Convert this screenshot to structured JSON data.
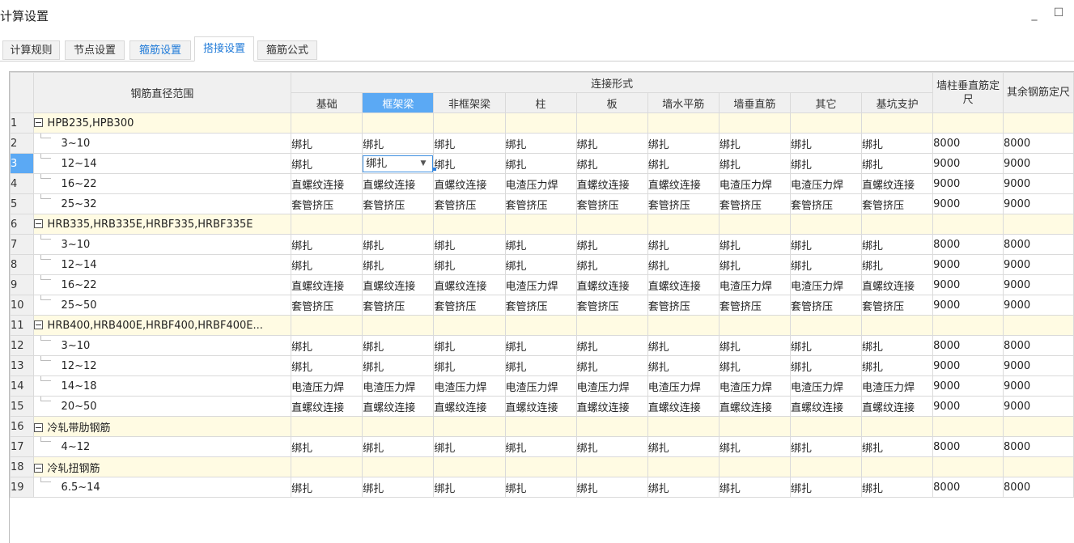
{
  "window": {
    "title": "计算设置",
    "minimize_glyph": "_",
    "maximize_glyph": "☐"
  },
  "tabs": [
    {
      "label": "计算规则"
    },
    {
      "label": "节点设置"
    },
    {
      "label": "箍筋设置"
    },
    {
      "label": "搭接设置"
    },
    {
      "label": "箍筋公式"
    }
  ],
  "table": {
    "header": {
      "diameter_range": "钢筋直径范围",
      "connection_form": "连接形式",
      "connection_columns": [
        "基础",
        "框架梁",
        "非框架梁",
        "柱",
        "板",
        "墙水平筋",
        "墙垂直筋",
        "其它",
        "基坑支护"
      ],
      "wall_col_length": "墙柱垂直筋定尺",
      "other_length": "其余钢筋定尺"
    },
    "rows": [
      {
        "num": "1",
        "type": "group",
        "name": "HPB235,HPB300"
      },
      {
        "num": "2",
        "type": "item",
        "name": "3~10",
        "values": [
          "绑扎",
          "绑扎",
          "绑扎",
          "绑扎",
          "绑扎",
          "绑扎",
          "绑扎",
          "绑扎",
          "绑扎"
        ],
        "wall": "8000",
        "other": "8000"
      },
      {
        "num": "3",
        "type": "item",
        "name": "12~14",
        "values": [
          "绑扎",
          "绑扎",
          "绑扎",
          "绑扎",
          "绑扎",
          "绑扎",
          "绑扎",
          "绑扎",
          "绑扎"
        ],
        "wall": "9000",
        "other": "9000"
      },
      {
        "num": "4",
        "type": "item",
        "name": "16~22",
        "values": [
          "直螺纹连接",
          "直螺纹连接",
          "直螺纹连接",
          "电渣压力焊",
          "直螺纹连接",
          "直螺纹连接",
          "电渣压力焊",
          "电渣压力焊",
          "直螺纹连接"
        ],
        "wall": "9000",
        "other": "9000"
      },
      {
        "num": "5",
        "type": "item",
        "name": "25~32",
        "values": [
          "套管挤压",
          "套管挤压",
          "套管挤压",
          "套管挤压",
          "套管挤压",
          "套管挤压",
          "套管挤压",
          "套管挤压",
          "套管挤压"
        ],
        "wall": "9000",
        "other": "9000"
      },
      {
        "num": "6",
        "type": "group",
        "name": "HRB335,HRB335E,HRBF335,HRBF335E"
      },
      {
        "num": "7",
        "type": "item",
        "name": "3~10",
        "values": [
          "绑扎",
          "绑扎",
          "绑扎",
          "绑扎",
          "绑扎",
          "绑扎",
          "绑扎",
          "绑扎",
          "绑扎"
        ],
        "wall": "8000",
        "other": "8000"
      },
      {
        "num": "8",
        "type": "item",
        "name": "12~14",
        "values": [
          "绑扎",
          "绑扎",
          "绑扎",
          "绑扎",
          "绑扎",
          "绑扎",
          "绑扎",
          "绑扎",
          "绑扎"
        ],
        "wall": "9000",
        "other": "9000"
      },
      {
        "num": "9",
        "type": "item",
        "name": "16~22",
        "values": [
          "直螺纹连接",
          "直螺纹连接",
          "直螺纹连接",
          "电渣压力焊",
          "直螺纹连接",
          "直螺纹连接",
          "电渣压力焊",
          "电渣压力焊",
          "直螺纹连接"
        ],
        "wall": "9000",
        "other": "9000"
      },
      {
        "num": "10",
        "type": "item",
        "name": "25~50",
        "values": [
          "套管挤压",
          "套管挤压",
          "套管挤压",
          "套管挤压",
          "套管挤压",
          "套管挤压",
          "套管挤压",
          "套管挤压",
          "套管挤压"
        ],
        "wall": "9000",
        "other": "9000"
      },
      {
        "num": "11",
        "type": "group",
        "name": "HRB400,HRB400E,HRBF400,HRBF400E..."
      },
      {
        "num": "12",
        "type": "item",
        "name": "3~10",
        "values": [
          "绑扎",
          "绑扎",
          "绑扎",
          "绑扎",
          "绑扎",
          "绑扎",
          "绑扎",
          "绑扎",
          "绑扎"
        ],
        "wall": "8000",
        "other": "8000"
      },
      {
        "num": "13",
        "type": "item",
        "name": "12~12",
        "values": [
          "绑扎",
          "绑扎",
          "绑扎",
          "绑扎",
          "绑扎",
          "绑扎",
          "绑扎",
          "绑扎",
          "绑扎"
        ],
        "wall": "9000",
        "other": "9000"
      },
      {
        "num": "14",
        "type": "item",
        "name": "14~18",
        "values": [
          "电渣压力焊",
          "电渣压力焊",
          "电渣压力焊",
          "电渣压力焊",
          "电渣压力焊",
          "电渣压力焊",
          "电渣压力焊",
          "电渣压力焊",
          "电渣压力焊"
        ],
        "wall": "9000",
        "other": "9000"
      },
      {
        "num": "15",
        "type": "item",
        "name": "20~50",
        "values": [
          "直螺纹连接",
          "直螺纹连接",
          "直螺纹连接",
          "直螺纹连接",
          "直螺纹连接",
          "直螺纹连接",
          "直螺纹连接",
          "直螺纹连接",
          "直螺纹连接"
        ],
        "wall": "9000",
        "other": "9000"
      },
      {
        "num": "16",
        "type": "group",
        "name": "冷轧带肋钢筋"
      },
      {
        "num": "17",
        "type": "item",
        "name": "4~12",
        "values": [
          "绑扎",
          "绑扎",
          "绑扎",
          "绑扎",
          "绑扎",
          "绑扎",
          "绑扎",
          "绑扎",
          "绑扎"
        ],
        "wall": "8000",
        "other": "8000"
      },
      {
        "num": "18",
        "type": "group",
        "name": "冷轧扭钢筋"
      },
      {
        "num": "19",
        "type": "item",
        "name": "6.5~14",
        "values": [
          "绑扎",
          "绑扎",
          "绑扎",
          "绑扎",
          "绑扎",
          "绑扎",
          "绑扎",
          "绑扎",
          "绑扎"
        ],
        "wall": "8000",
        "other": "8000"
      }
    ]
  }
}
